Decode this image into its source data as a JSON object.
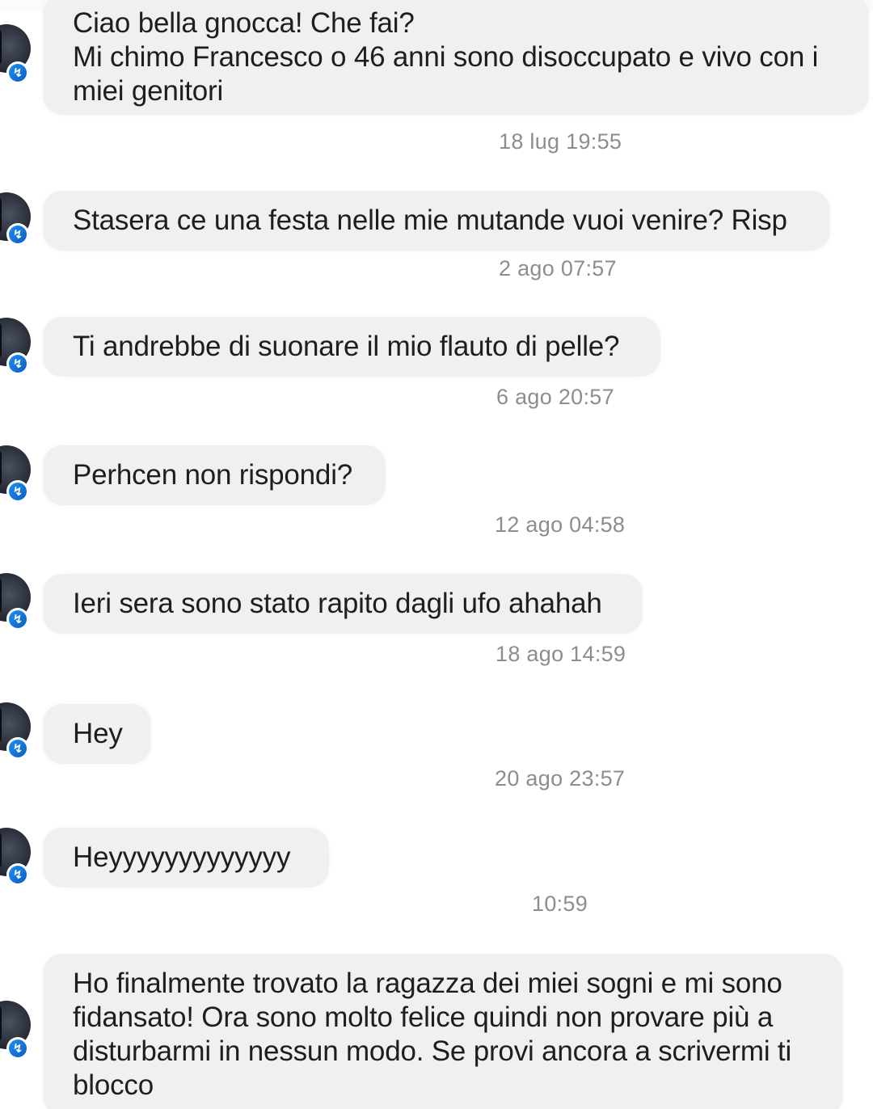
{
  "conversation": {
    "messages": [
      {
        "lines": [
          "Ciao bella gnocca! Che fai?",
          "Mi chimo Francesco o 46 anni sono disoccupato e vivo con i",
          "miei genitori"
        ],
        "time": "18 lug 19:55"
      },
      {
        "lines": [
          "Stasera ce una festa nelle mie mutande vuoi venire? Risp"
        ],
        "time": "2 ago 07:57"
      },
      {
        "lines": [
          "Ti andrebbe di suonare il mio flauto di pelle?"
        ],
        "time": "6 ago 20:57"
      },
      {
        "lines": [
          "Perhcen non rispondi?"
        ],
        "time": "12 ago 04:58"
      },
      {
        "lines": [
          "Ieri sera sono stato rapito dagli ufo ahahah"
        ],
        "time": "18 ago 14:59"
      },
      {
        "lines": [
          "Hey"
        ],
        "time": "20 ago 23:57"
      },
      {
        "lines": [
          "Heyyyyyyyyyyyyy"
        ],
        "time": "10:59"
      },
      {
        "lines": [
          "Ho finalmente trovato la ragazza dei miei sogni e mi sono",
          "fidansato! Ora sono molto felice quindi non provare più a",
          "disturbarmi in nessun modo. Se provi ancora a scrivermi ti",
          "blocco"
        ],
        "time": ""
      }
    ]
  },
  "icons": {
    "avatar": "avatar",
    "messenger_badge": "messenger-icon"
  },
  "colors": {
    "bubble": "#f0f0f0",
    "timestamp": "#8a8d91",
    "badge": "#1f8ef1"
  }
}
